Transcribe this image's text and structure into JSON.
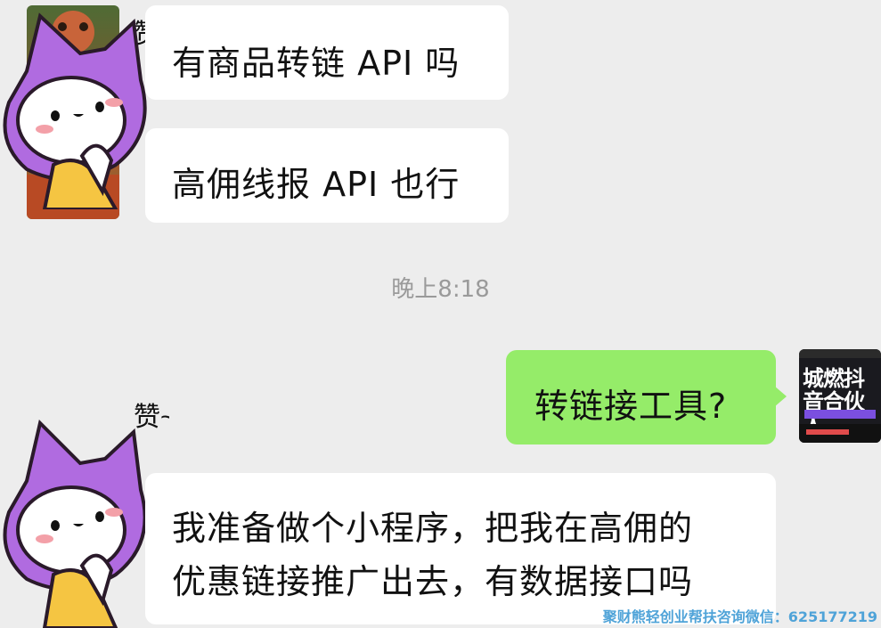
{
  "messages": [
    {
      "id": "m1",
      "side": "left",
      "text": "有商品转链 API 吗"
    },
    {
      "id": "m2",
      "side": "left",
      "text": "高佣线报 API 也行"
    },
    {
      "id": "m3",
      "side": "right",
      "text": "转链接工具?"
    },
    {
      "id": "m4",
      "side": "left",
      "lines": [
        "我准备做个小程序，把我在高佣的",
        "优惠链接推广出去，有数据接口吗"
      ]
    }
  ],
  "timestamp": "晚上8:18",
  "stickers": [
    {
      "caption": "赞~"
    },
    {
      "caption": "赞~"
    }
  ],
  "thumbnail": {
    "title": "城燃抖音合伙人"
  },
  "watermark": "聚财熊轻创业帮扶咨询微信：625177219",
  "colors": {
    "background": "#ededed",
    "bubble_in": "#ffffff",
    "bubble_out": "#95ec69",
    "sticker_purple": "#b06be0"
  }
}
